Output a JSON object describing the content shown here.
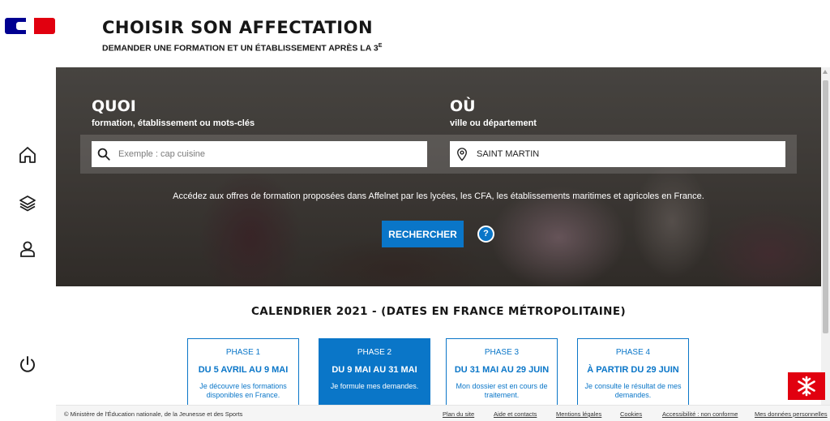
{
  "header": {
    "title": "CHOISIR SON AFFECTATION",
    "subtitle": "DEMANDER UNE FORMATION ET UN ÉTABLISSEMENT APRÈS LA 3",
    "subtitle_sup": "E"
  },
  "nav": {
    "items": [
      {
        "name": "home",
        "icon": "home-icon"
      },
      {
        "name": "layers",
        "icon": "layers-icon"
      },
      {
        "name": "account",
        "icon": "user-icon"
      },
      {
        "name": "logout",
        "icon": "power-icon"
      }
    ]
  },
  "search": {
    "what_label": "QUOI",
    "what_sub": "formation, établissement ou mots-clés",
    "what_placeholder": "Exemple : cap cuisine",
    "where_label": "OÙ",
    "where_sub": "ville ou département",
    "where_value": "SAINT MARTIN",
    "info": "Accédez aux offres de formation proposées dans Affelnet par les lycées, les CFA, les établissements maritimes et agricoles en France.",
    "button": "RECHERCHER",
    "help": "?"
  },
  "calendar": {
    "title": "CALENDRIER 2021 - (DATES EN FRANCE MÉTROPOLITAINE)",
    "phases": [
      {
        "name": "PHASE 1",
        "dates": "DU 5 AVRIL AU 9 MAI",
        "desc": "Je découvre les formations disponibles en France."
      },
      {
        "name": "PHASE 2",
        "dates": "DU 9 MAI AU 31 MAI",
        "desc": "Je formule mes demandes."
      },
      {
        "name": "PHASE 3",
        "dates": "DU 31 MAI AU 29 JUIN",
        "desc": "Mon dossier est en cours de traitement."
      },
      {
        "name": "PHASE 4",
        "dates": "À PARTIR DU 29 JUIN",
        "desc": "Je consulte le résultat de mes demandes."
      }
    ]
  },
  "footer": {
    "copyright": "© Ministère de l'Éducation nationale, de la Jeunesse et des Sports",
    "links": [
      "Plan du site",
      "Aide et contacts",
      "Mentions légales",
      "Cookies",
      "Accessibilité : non conforme",
      "Mes données personnelles"
    ]
  },
  "colors": {
    "primary": "#0a76c8",
    "marianne_blue": "#000091",
    "marianne_red": "#e1000f"
  }
}
